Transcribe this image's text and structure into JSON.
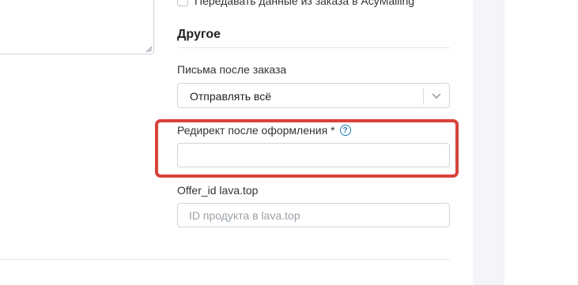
{
  "crm_checkbox": {
    "label": "Передавать данные из заказа в AcyMailing"
  },
  "section": {
    "title": "Другое"
  },
  "emails_after_order": {
    "label": "Письма после заказа",
    "selected": "Отправлять всё"
  },
  "redirect": {
    "label": "Редирект после оформления",
    "required_mark": "*",
    "help": "?",
    "value": "",
    "highlight_color": "#d9423a"
  },
  "offer_id": {
    "label": "Offer_id lava.top",
    "placeholder": "ID продукта в lava.top",
    "value": ""
  }
}
